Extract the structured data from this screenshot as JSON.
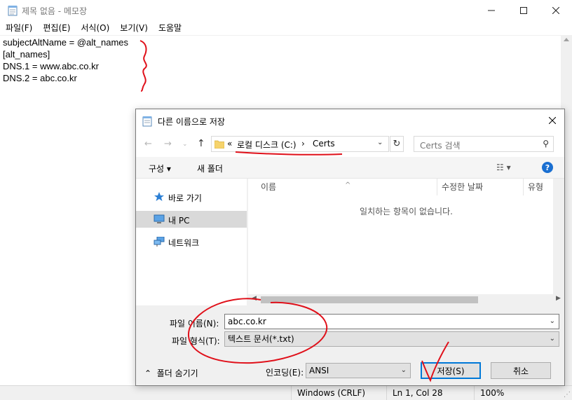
{
  "notepad": {
    "title": "제목 없음 - 메모장",
    "menu": [
      "파일(F)",
      "편집(E)",
      "서식(O)",
      "보기(V)",
      "도움말"
    ],
    "lines": [
      "subjectAltName = @alt_names",
      "[alt_names]",
      "DNS.1 = www.abc.co.kr",
      "DNS.2 = abc.co.kr"
    ],
    "status": {
      "line_ending": "Windows (CRLF)",
      "position": "Ln 1, Col 28",
      "zoom": "100%"
    }
  },
  "dialog": {
    "title": "다른 이름으로 저장",
    "address": {
      "prefix": "«",
      "segments": [
        "로컬 디스크 (C:)",
        "Certs"
      ],
      "separator": "›"
    },
    "search_placeholder": "Certs 검색",
    "toolbar": {
      "organize": "구성 ▾",
      "new_folder": "새 폴더"
    },
    "nav_items": [
      {
        "label": "바로 가기",
        "icon": "star-icon"
      },
      {
        "label": "내 PC",
        "icon": "computer-icon",
        "selected": true
      },
      {
        "label": "네트워크",
        "icon": "network-icon"
      }
    ],
    "columns": [
      "이름",
      "수정한 날짜",
      "유형"
    ],
    "empty_message": "일치하는 항목이 없습니다.",
    "filename_label": "파일 이름(N):",
    "filename_value": "abc.co.kr",
    "filetype_label": "파일 형식(T):",
    "filetype_value": "텍스트 문서(*.txt)",
    "hide_folders": "폴더 숨기기",
    "encoding_label": "인코딩(E):",
    "encoding_value": "ANSI",
    "save_button": "저장(S)",
    "cancel_button": "취소"
  },
  "colors": {
    "accent": "#0078d7",
    "annotation": "#e0101a",
    "selected_nav": "#d9d9d9"
  }
}
